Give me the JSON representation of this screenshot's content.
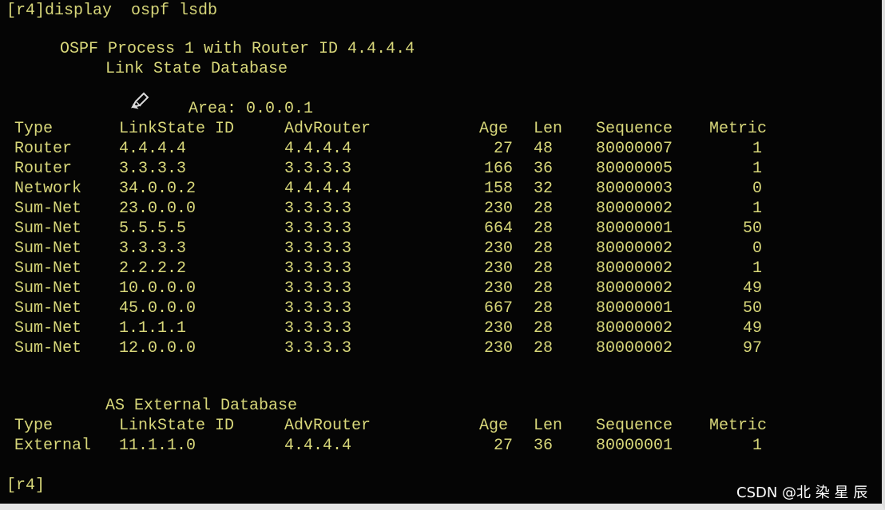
{
  "terminal": {
    "command": "[r4]display  ospf lsdb",
    "process_line": "OSPF Process 1 with Router ID 4.4.4.4",
    "database_title": "Link State Database",
    "area_label": "Area: 0.0.0.1",
    "headers": [
      "Type",
      "LinkState ID",
      "AdvRouter",
      "Age",
      "Len",
      "Sequence",
      "Metric"
    ],
    "rows": [
      [
        "Router",
        "4.4.4.4",
        "4.4.4.4",
        "27",
        "48",
        "80000007",
        "1"
      ],
      [
        "Router",
        "3.3.3.3",
        "3.3.3.3",
        "166",
        "36",
        "80000005",
        "1"
      ],
      [
        "Network",
        "34.0.0.2",
        "4.4.4.4",
        "158",
        "32",
        "80000003",
        "0"
      ],
      [
        "Sum-Net",
        "23.0.0.0",
        "3.3.3.3",
        "230",
        "28",
        "80000002",
        "1"
      ],
      [
        "Sum-Net",
        "5.5.5.5",
        "3.3.3.3",
        "664",
        "28",
        "80000001",
        "50"
      ],
      [
        "Sum-Net",
        "3.3.3.3",
        "3.3.3.3",
        "230",
        "28",
        "80000002",
        "0"
      ],
      [
        "Sum-Net",
        "2.2.2.2",
        "3.3.3.3",
        "230",
        "28",
        "80000002",
        "1"
      ],
      [
        "Sum-Net",
        "10.0.0.0",
        "3.3.3.3",
        "230",
        "28",
        "80000002",
        "49"
      ],
      [
        "Sum-Net",
        "45.0.0.0",
        "3.3.3.3",
        "667",
        "28",
        "80000001",
        "50"
      ],
      [
        "Sum-Net",
        "1.1.1.1",
        "3.3.3.3",
        "230",
        "28",
        "80000002",
        "49"
      ],
      [
        "Sum-Net",
        "12.0.0.0",
        "3.3.3.3",
        "230",
        "28",
        "80000002",
        "97"
      ]
    ],
    "external_title": "AS External Database",
    "external_headers": [
      "Type",
      "LinkState ID",
      "AdvRouter",
      "Age",
      "Len",
      "Sequence",
      "Metric"
    ],
    "external_rows": [
      [
        "External",
        "11.1.1.0",
        "4.4.4.4",
        "27",
        "36",
        "80000001",
        "1"
      ]
    ],
    "prompt": "[r4]",
    "text_color": "#d8d77a",
    "background_color": "#050505"
  },
  "cursor": {
    "icon": "pen-cursor-icon"
  },
  "watermark": {
    "text": "CSDN @北 染 星 辰"
  }
}
